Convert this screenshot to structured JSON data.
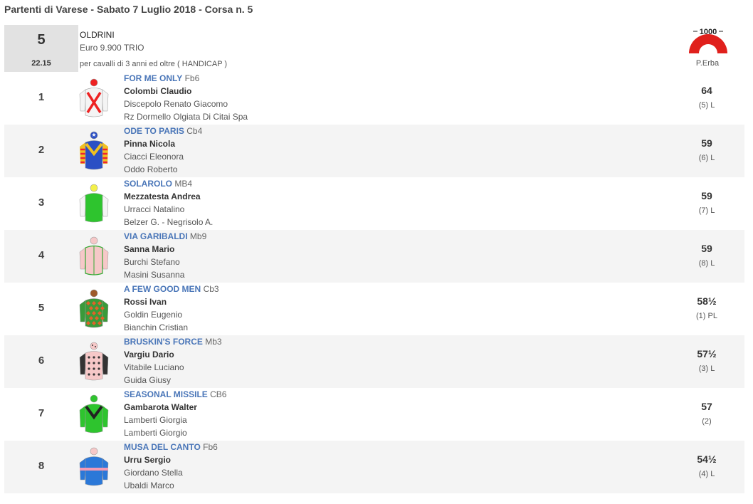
{
  "page": {
    "title": "Partenti di Varese - Sabato 7 Luglio 2018 - Corsa n. 5"
  },
  "race": {
    "number": "5",
    "time": "22.15",
    "name": "OLDRINI",
    "prize": "Euro 9.900 TRIO",
    "conditions": "per cavalli di 3 anni ed oltre ( HANDICAP )",
    "track_logo_text": "1000",
    "track_name": "P.Erba"
  },
  "runners": [
    {
      "num": "1",
      "horse": "FOR ME ONLY",
      "info": "Fb6",
      "jockey": "Colombi Claudio",
      "trainer": "Discepolo Renato Giacomo",
      "owner": "Rz Dormello Olgiata Di Citai Spa",
      "weight": "64",
      "draw": "(5) L",
      "silk": "red-cross-white"
    },
    {
      "num": "2",
      "horse": "ODE TO PARIS",
      "info": "Cb4",
      "jockey": "Pinna Nicola",
      "trainer": "Ciacci Eleonora",
      "owner": "Oddo Roberto",
      "weight": "59",
      "draw": "(6) L",
      "silk": "blue-yellow-chevron"
    },
    {
      "num": "3",
      "horse": "SOLAROLO",
      "info": "MB4",
      "jockey": "Mezzatesta Andrea",
      "trainer": "Urracci Natalino",
      "owner": "Belzer G. - Negrisolo A.",
      "weight": "59",
      "draw": "(7) L",
      "silk": "green-white"
    },
    {
      "num": "4",
      "horse": "VIA GARIBALDI",
      "info": "Mb9",
      "jockey": "Sanna Mario",
      "trainer": "Burchi Stefano",
      "owner": "Masini Susanna",
      "weight": "59",
      "draw": "(8) L",
      "silk": "pink-green-trim"
    },
    {
      "num": "5",
      "horse": "A FEW GOOD MEN",
      "info": "Cb3",
      "jockey": "Rossi Ivan",
      "trainer": "Goldin Eugenio",
      "owner": "Bianchin Cristian",
      "weight": "58½",
      "draw": "(1) PL",
      "silk": "green-red-diamonds"
    },
    {
      "num": "6",
      "horse": "BRUSKIN'S FORCE",
      "info": "Mb3",
      "jockey": "Vargiu Dario",
      "trainer": "Vitabile Luciano",
      "owner": "Guida Giusy",
      "weight": "57½",
      "draw": "(3) L",
      "silk": "pink-black-spots"
    },
    {
      "num": "7",
      "horse": "SEASONAL MISSILE",
      "info": "CB6",
      "jockey": "Gambarota Walter",
      "trainer": "Lamberti Giorgia",
      "owner": "Lamberti Giorgio",
      "weight": "57",
      "draw": "(2)",
      "silk": "green-black-chevron"
    },
    {
      "num": "8",
      "horse": "MUSA DEL CANTO",
      "info": "Fb6",
      "jockey": "Urru Sergio",
      "trainer": "Giordano Stella",
      "owner": "Ubaldi Marco",
      "weight": "54½",
      "draw": "(4) L",
      "silk": "blue-pink-hoops"
    }
  ]
}
